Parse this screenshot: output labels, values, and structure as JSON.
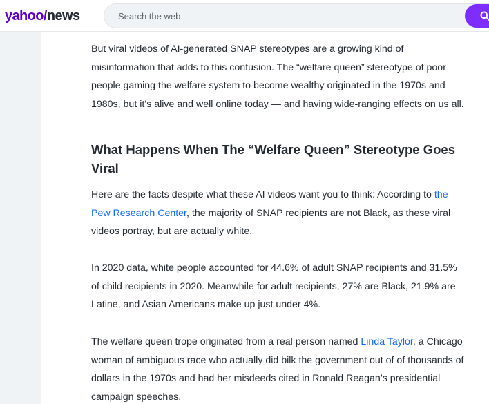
{
  "header": {
    "logo_yahoo": "yahoo",
    "logo_slash": "/",
    "logo_news": "news",
    "search_placeholder": "Search the web"
  },
  "article": {
    "paragraph1": "But viral videos of AI-generated SNAP stereotypes are a growing kind of misinformation that adds to this confusion. The “welfare queen” stereotype of poor people gaming the welfare system to become wealthy originated in the 1970s and 1980s, but it’s alive and well online today — and having wide-ranging effects on us all.",
    "heading": "What Happens When The “Welfare Queen” Stereotype Goes Viral",
    "paragraph2_before": "Here are the facts despite what these AI videos want you to think: According to ",
    "paragraph2_link": "the Pew Research Center",
    "paragraph2_after": ", the majority of SNAP recipients are not Black, as these viral videos portray, but are actually white.",
    "paragraph3": "In 2020 data, white people accounted for 44.6% of adult SNAP recipients and 31.5% of child recipients in 2020. Meanwhile for adult recipients, 27% are Black, 21.9% are Latine, and Asian Americans make up just under 4%.",
    "paragraph4_before": "The welfare queen trope originated from a real person named ",
    "paragraph4_link": "Linda Taylor",
    "paragraph4_after": ", a Chicago woman of ambiguous race who actually did bilk the government out of of thousands of dollars in the 1970s and had her misdeeds cited in Ronald Reagan’s presidential campaign speeches."
  },
  "colors": {
    "brand_purple": "#6001d2",
    "search_button": "#7d2eff",
    "link_blue": "#0f69ff",
    "text": "#232a31"
  },
  "icons": {
    "search_button_icon": "search-icon"
  }
}
